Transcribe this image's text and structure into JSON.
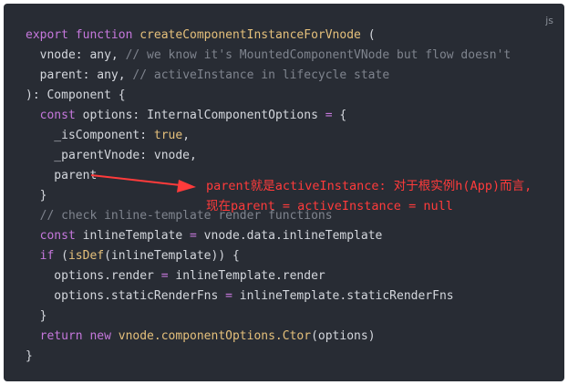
{
  "lang_label": "js",
  "code": {
    "l1": {
      "kw": "export function",
      "name": "createComponentInstanceForVnode",
      "rest": " ("
    },
    "l2": {
      "code": "  vnode: any,",
      "comment": " // we know it's MountedComponentVNode but flow doesn't"
    },
    "l3": {
      "code": "  parent: any,",
      "comment": " // activeInstance in lifecycle state"
    },
    "l4": {
      "code": "): Component {"
    },
    "l5": {
      "kw": "  const",
      "code": " options: InternalComponentOptions ",
      "op": "=",
      "rest": " {"
    },
    "l6": {
      "code": "    _isComponent: ",
      "val": "true",
      "rest": ","
    },
    "l7": {
      "code": "    _parentVnode: vnode,"
    },
    "l8": {
      "code": "    parent"
    },
    "l9": {
      "code": "  }"
    },
    "l10": {
      "comment": "  // check inline-template render functions"
    },
    "l11": {
      "kw": "  const",
      "code": " inlineTemplate ",
      "op": "=",
      "rest": " vnode.data.inlineTemplate"
    },
    "l12": {
      "kw": "  if",
      "code": " (",
      "fn": "isDef",
      "rest": "(inlineTemplate)) {"
    },
    "l13": {
      "code": "    options.render ",
      "op": "=",
      "rest": " inlineTemplate.render"
    },
    "l14": {
      "code": "    options.staticRenderFns ",
      "op": "=",
      "rest": " inlineTemplate.staticRenderFns"
    },
    "l15": {
      "code": "  }"
    },
    "l16": {
      "kw": "  return new",
      "fn": " vnode.componentOptions.Ctor",
      "rest": "(options)"
    },
    "l17": {
      "code": "}"
    }
  },
  "annotation": {
    "line1": "parent就是activeInstance: 对于根实例h(App)而言,",
    "line2": "现在parent = activeInstance = null",
    "color": "#ff3b3b"
  }
}
